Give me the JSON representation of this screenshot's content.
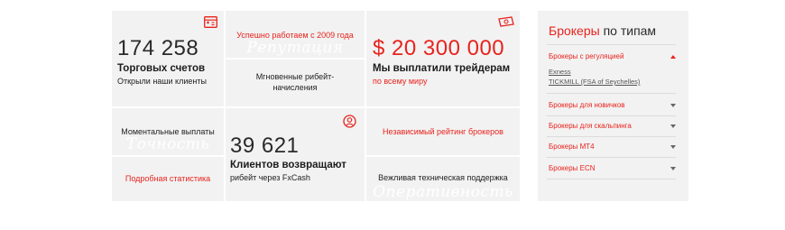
{
  "stats": {
    "accounts": {
      "number": "174 258",
      "title": "Торговых счетов",
      "subtitle": "Открыли наши клиенты"
    },
    "reputation": {
      "headline": "Успешно работаем с 2009 года",
      "watermark": "Репутация"
    },
    "instant_rebate": {
      "text_line1": "Мгновенные рибейт-",
      "text_line2": "начисления"
    },
    "paid": {
      "number": "$ 20 300 000",
      "title": "Мы выплатили трейдерам",
      "subtitle": "по всему миру"
    },
    "instant_payouts": {
      "text": "Моментальные выплаты",
      "watermark": "Точность"
    },
    "detailed_stats": {
      "text": "Подробная статистика"
    },
    "returning": {
      "number": "39 621",
      "title": "Клиентов возвращают",
      "subtitle": "рибейт через FxCash"
    },
    "rating": {
      "text": "Независимый рейтинг брокеров"
    },
    "support": {
      "text": "Вежливая техническая поддержка",
      "watermark": "Оперативность"
    }
  },
  "sidebar": {
    "title_colored": "Брокеры",
    "title_rest": " по типам",
    "items": [
      {
        "label": "Брокеры с регуляцией",
        "expanded": true,
        "subitems": [
          "Exness",
          "TICKMILL (FSA of Seychelles)"
        ]
      },
      {
        "label": "Брокеры для новичков",
        "expanded": false
      },
      {
        "label": "Брокеры для скальпинга",
        "expanded": false
      },
      {
        "label": "Брокеры МТ4",
        "expanded": false
      },
      {
        "label": "Брокеры ECN",
        "expanded": false
      }
    ]
  },
  "colors": {
    "accent": "#e8231d",
    "panel": "#f2f2f2",
    "text": "#1c1c1c"
  },
  "icons": {
    "accounts": "calculator-icon",
    "paid": "money-icon",
    "returning": "user-circle-icon"
  }
}
